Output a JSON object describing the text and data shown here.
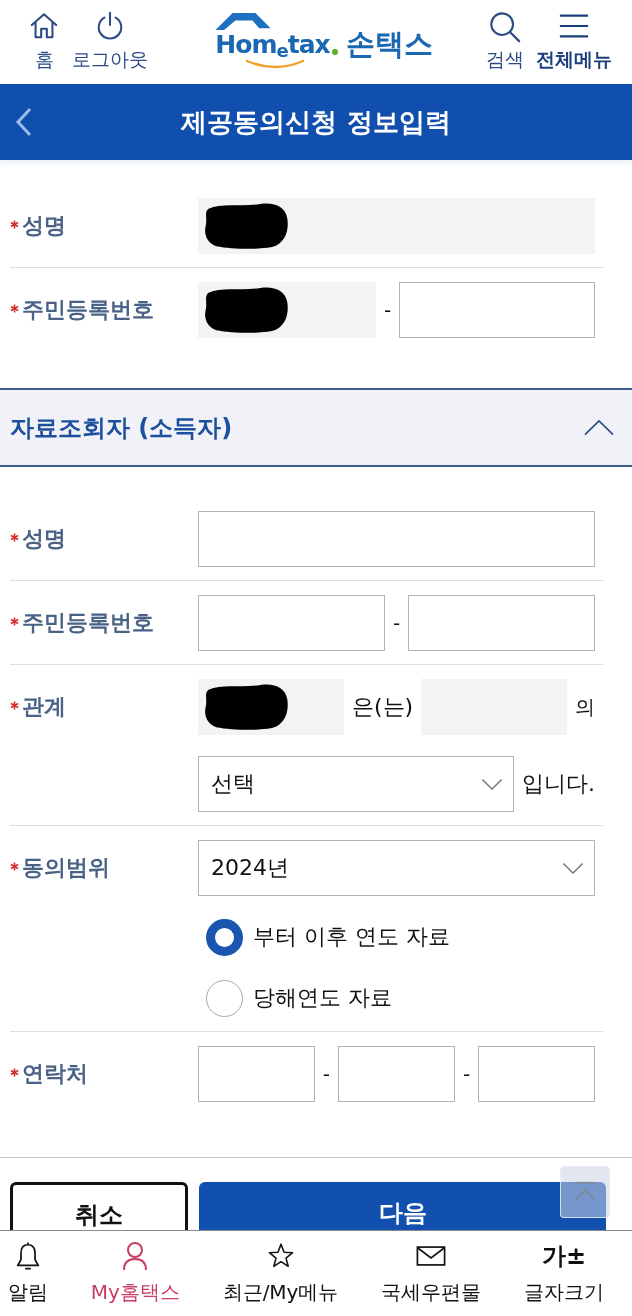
{
  "header": {
    "left_buttons": [
      {
        "kind": "home",
        "label": "홈",
        "emphasized": false
      },
      {
        "kind": "power",
        "label": "로그아웃",
        "emphasized": false
      }
    ],
    "logo": {
      "wordmark": "Hom$_{e}$tax",
      "app_name": "손택스"
    },
    "right_buttons": [
      {
        "kind": "search",
        "label": "검색",
        "emphasized": false
      },
      {
        "kind": "menu",
        "label": "전체메뉴",
        "emphasized": true
      }
    ]
  },
  "title_bar": {
    "title": "제공동의신청 정보입력"
  },
  "consenter": {
    "rows": [
      {
        "label": "성명",
        "required": true,
        "lines": [
          [
            {
              "kind": "readonly",
              "redacted": true
            }
          ]
        ]
      },
      {
        "label": "주민등록번호",
        "required": true,
        "lines": [
          [
            {
              "kind": "readonly",
              "redacted": true
            },
            {
              "kind": "text",
              "text": "-"
            },
            {
              "kind": "input"
            }
          ]
        ]
      }
    ]
  },
  "viewer_section": {
    "title": "자료조회자 (소득자)",
    "expanded": true,
    "rows": [
      {
        "label": "성명",
        "required": true,
        "lines": [
          [
            {
              "kind": "input"
            }
          ]
        ]
      },
      {
        "label": "주민등록번호",
        "required": true,
        "lines": [
          [
            {
              "kind": "input"
            },
            {
              "kind": "text",
              "text": "-"
            },
            {
              "kind": "input"
            }
          ]
        ]
      },
      {
        "label": "관계",
        "required": true,
        "lines": [
          [
            {
              "kind": "readonly",
              "redacted": true
            },
            {
              "kind": "text",
              "text": "은(는)"
            },
            {
              "kind": "readonly",
              "redacted": false
            },
            {
              "kind": "text",
              "text": "의"
            }
          ],
          [
            {
              "kind": "select",
              "value": "선택"
            },
            {
              "kind": "text",
              "text": "입니다."
            }
          ]
        ]
      },
      {
        "label": "동의범위",
        "required": true,
        "lines": [
          [
            {
              "kind": "select",
              "value": "2024년"
            }
          ],
          [
            {
              "kind": "radio",
              "label": "부터 이후 연도 자료",
              "selected": true
            }
          ],
          [
            {
              "kind": "radio",
              "label": "당해연도 자료",
              "selected": false
            }
          ]
        ]
      },
      {
        "label": "연락처",
        "required": true,
        "lines": [
          [
            {
              "kind": "input"
            },
            {
              "kind": "text",
              "text": "-"
            },
            {
              "kind": "input"
            },
            {
              "kind": "text",
              "text": "-"
            },
            {
              "kind": "input"
            }
          ]
        ]
      }
    ]
  },
  "actions": [
    {
      "kind": "secondary",
      "label": "취소"
    },
    {
      "kind": "primary",
      "label": "다음"
    }
  ],
  "bottom_nav": [
    {
      "kind": "bell",
      "label": "알림",
      "selected": false
    },
    {
      "kind": "person",
      "label": "My홈택스",
      "selected": true
    },
    {
      "kind": "star",
      "label": "최근/My메뉴",
      "selected": false
    },
    {
      "kind": "mail",
      "label": "국세우편물",
      "selected": false
    },
    {
      "kind": "font_size",
      "glyph": "가±",
      "label": "글자크기",
      "selected": false
    }
  ]
}
